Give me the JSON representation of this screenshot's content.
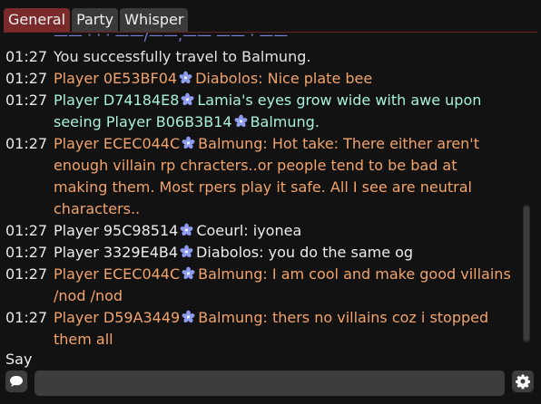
{
  "tabs": [
    {
      "label": "General",
      "active": true
    },
    {
      "label": "Party",
      "active": false
    },
    {
      "label": "Whisper",
      "active": false
    }
  ],
  "log": {
    "cut_off_fragment": "—— · · · ——/——,—— —— · ——",
    "lines": [
      {
        "time": "01:27",
        "kind": "system",
        "text": "You successfully travel to Balmung."
      },
      {
        "time": "01:27",
        "kind": "say",
        "name": "Player 0E53BF04",
        "world": "Diabolos",
        "text": ": Nice plate bee"
      },
      {
        "time": "01:27",
        "kind": "emote",
        "name": "Player D74184E8",
        "world": "Lamia",
        "text": "'s eyes grow wide with awe upon seeing Player B06B3B14",
        "world2": "Balmung",
        "suffix": "."
      },
      {
        "time": "01:27",
        "kind": "say",
        "name": "Player ECEC044C",
        "world": "Balmung",
        "text": ": Hot take: There either aren't enough villain rp chracters..or people tend to be bad at making them. Most rpers play it safe. All I see are neutral characters.."
      },
      {
        "time": "01:27",
        "kind": "white",
        "name": "Player 95C98514",
        "world": "Coeurl",
        "text": ": iyonea"
      },
      {
        "time": "01:27",
        "kind": "white",
        "name": "Player 3329E4B4",
        "world": "Diabolos",
        "text": ": you do the same og"
      },
      {
        "time": "01:27",
        "kind": "say",
        "name": "Player ECEC044C",
        "world": "Balmung",
        "text": ": I am cool and make good villains /nod /nod"
      },
      {
        "time": "01:27",
        "kind": "say",
        "name": "Player D59A3449",
        "world": "Balmung",
        "text": ": thers no villains coz i stopped them all"
      }
    ]
  },
  "input": {
    "channel_label": "Say",
    "value": "",
    "placeholder": ""
  },
  "icons": {
    "world": "cross-world-flower-icon",
    "bubble": "speech-bubble-icon",
    "settings": "gear-icon"
  },
  "colors": {
    "tab_active": "#7a2a2a",
    "say": "#f2a36c",
    "emote": "#a8f0dc",
    "system": "#e2e2e2",
    "world_icon": "#8e9cf0"
  }
}
